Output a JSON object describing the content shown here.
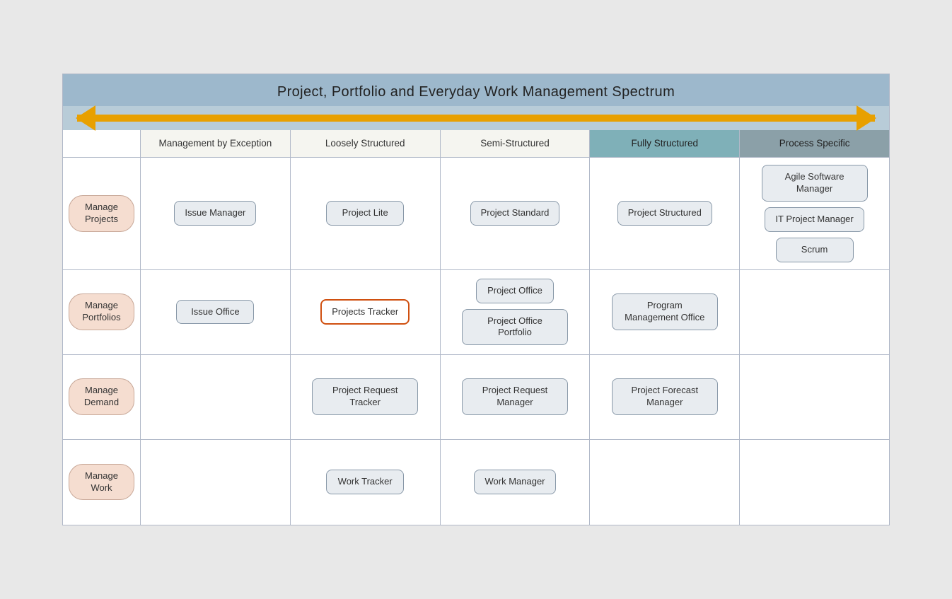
{
  "title": "Project, Portfolio and Everyday Work Management Spectrum",
  "columns": [
    {
      "label": "Management by\nException",
      "style": "normal"
    },
    {
      "label": "Loosely Structured",
      "style": "normal"
    },
    {
      "label": "Semi-Structured",
      "style": "normal"
    },
    {
      "label": "Fully Structured",
      "style": "teal"
    },
    {
      "label": "Process Specific",
      "style": "dark"
    }
  ],
  "rows": [
    {
      "label": "Manage\nProjects",
      "cells": [
        {
          "products": [
            "Issue Manager"
          ]
        },
        {
          "products": [
            "Project Lite"
          ]
        },
        {
          "products": [
            "Project Standard"
          ]
        },
        {
          "products": [
            "Project Structured"
          ]
        },
        {
          "products": [
            "Agile Software\nManager",
            "IT Project Manager",
            "Scrum"
          ]
        }
      ]
    },
    {
      "label": "Manage\nPortfolios",
      "cells": [
        {
          "products": [
            "Issue Office"
          ]
        },
        {
          "products": [
            "Projects Tracker"
          ],
          "highlighted": [
            0
          ]
        },
        {
          "products": [
            "Project Office",
            "Project Office\nPortfolio"
          ]
        },
        {
          "products": [
            "Program\nManagement\nOffice"
          ]
        },
        {
          "products": []
        }
      ]
    },
    {
      "label": "Manage\nDemand",
      "cells": [
        {
          "products": []
        },
        {
          "products": [
            "Project Request\nTracker"
          ]
        },
        {
          "products": [
            "Project Request\nManager"
          ]
        },
        {
          "products": [
            "Project Forecast\nManager"
          ]
        },
        {
          "products": []
        }
      ]
    },
    {
      "label": "Manage\nWork",
      "cells": [
        {
          "products": []
        },
        {
          "products": [
            "Work Tracker"
          ]
        },
        {
          "products": [
            "Work Manager"
          ]
        },
        {
          "products": []
        },
        {
          "products": []
        }
      ]
    }
  ]
}
